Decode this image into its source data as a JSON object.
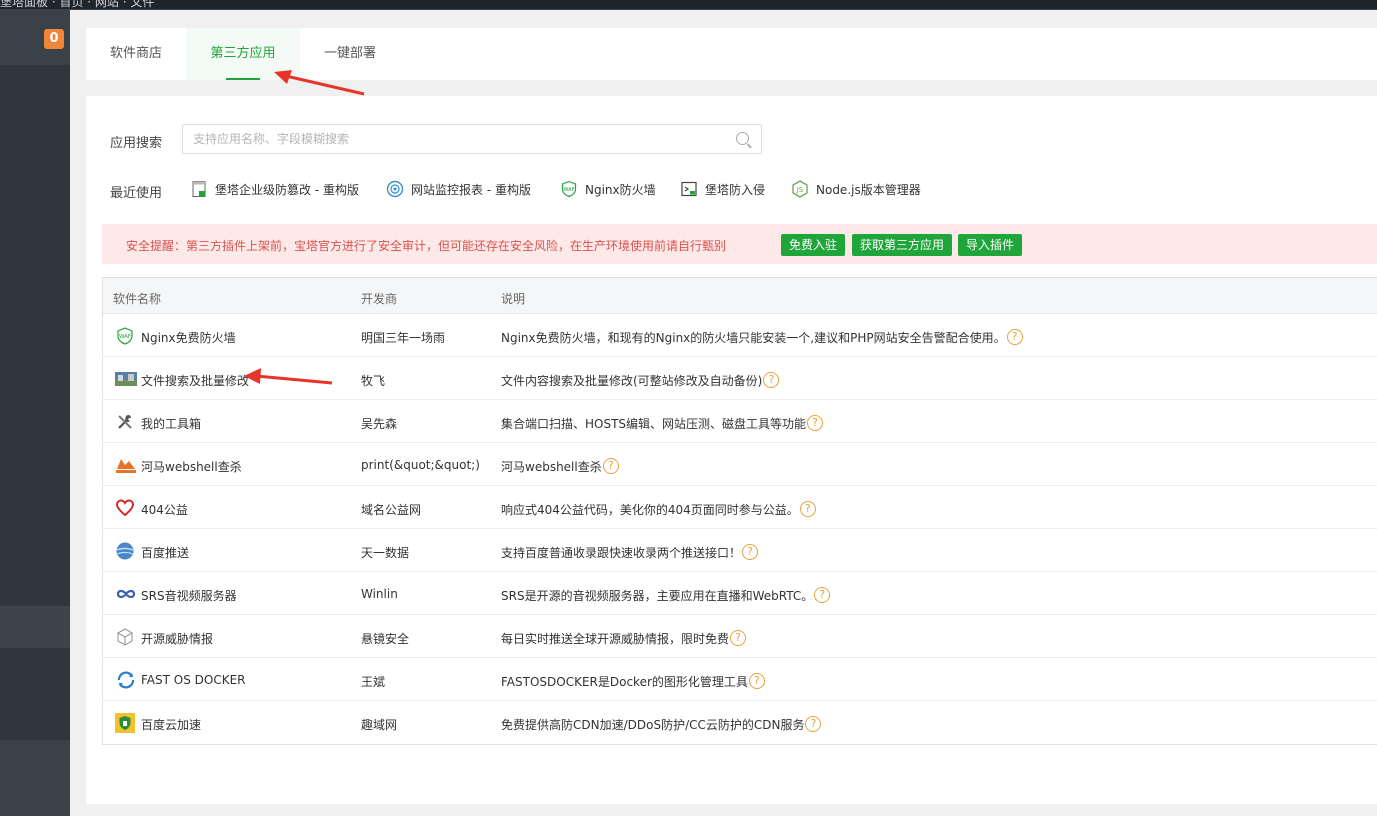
{
  "tabs": [
    {
      "label": "软件商店"
    },
    {
      "label": "第三方应用"
    },
    {
      "label": "一键部署"
    }
  ],
  "sidebar": {
    "badge": "0"
  },
  "search": {
    "label": "应用搜索",
    "placeholder": "支持应用名称、字段模糊搜索"
  },
  "recent": {
    "label": "最近使用",
    "items": [
      {
        "label": "堡塔企业级防篡改 - 重构版",
        "icon": "document-icon"
      },
      {
        "label": "网站监控报表 - 重构版",
        "icon": "monitor-icon"
      },
      {
        "label": "Nginx防火墙",
        "icon": "waf-icon"
      },
      {
        "label": "堡塔防入侵",
        "icon": "terminal-icon"
      },
      {
        "label": "Node.js版本管理器",
        "icon": "nodejs-icon"
      }
    ]
  },
  "warning": {
    "text": "安全提醒：第三方插件上架前，宝塔官方进行了安全审计，但可能还存在安全风险，在生产环境使用前请自行甄别",
    "buttons": [
      "免费入驻",
      "获取第三方应用",
      "导入插件"
    ]
  },
  "table": {
    "headers": [
      "软件名称",
      "开发商",
      "说明"
    ],
    "rows": [
      {
        "name": "Nginx免费防火墙",
        "dev": "明国三年一场雨",
        "desc": "Nginx免费防火墙，和现有的Nginx的防火墙只能安装一个,建议和PHP网站安全告警配合使用。",
        "icon": "waf-icon"
      },
      {
        "name": "文件搜索及批量修改",
        "dev": "牧飞",
        "desc": "文件内容搜索及批量修改(可整站修改及自动备份)",
        "icon": "file-search-icon"
      },
      {
        "name": "我的工具箱",
        "dev": "吴先森",
        "desc": "集合端口扫描、HOSTS编辑、网站压测、磁盘工具等功能",
        "icon": "tools-icon"
      },
      {
        "name": "河马webshell查杀",
        "dev": "print(&quot;&quot;)",
        "desc": "河马webshell查杀",
        "icon": "hippo-icon"
      },
      {
        "name": "404公益",
        "dev": "域名公益网",
        "desc": "响应式404公益代码，美化你的404页面同时参与公益。",
        "icon": "heart-icon"
      },
      {
        "name": "百度推送",
        "dev": "天一数据",
        "desc": "支持百度普通收录跟快速收录两个推送接口！",
        "icon": "globe-icon"
      },
      {
        "name": "SRS音视频服务器",
        "dev": "Winlin",
        "desc": "SRS是开源的音视频服务器，主要应用在直播和WebRTC。",
        "icon": "infinity-icon"
      },
      {
        "name": "开源威胁情报",
        "dev": "悬镜安全",
        "desc": "每日实时推送全球开源威胁情报，限时免费",
        "icon": "cube-icon"
      },
      {
        "name": "FAST OS DOCKER",
        "dev": "王斌",
        "desc": "FASTOSDOCKER是Docker的图形化管理工具",
        "icon": "docker-icon"
      },
      {
        "name": "百度云加速",
        "dev": "趣域网",
        "desc": "免费提供高防CDN加速/DDoS防护/CC云防护的CDN服务",
        "icon": "shield-icon"
      }
    ]
  },
  "colors": {
    "accent": "#20a53a",
    "warning_text": "#d9534f",
    "warning_bg": "#fde9e8",
    "help": "#e8a23a",
    "badge": "#f0863a",
    "arrow": "#e8352a"
  }
}
